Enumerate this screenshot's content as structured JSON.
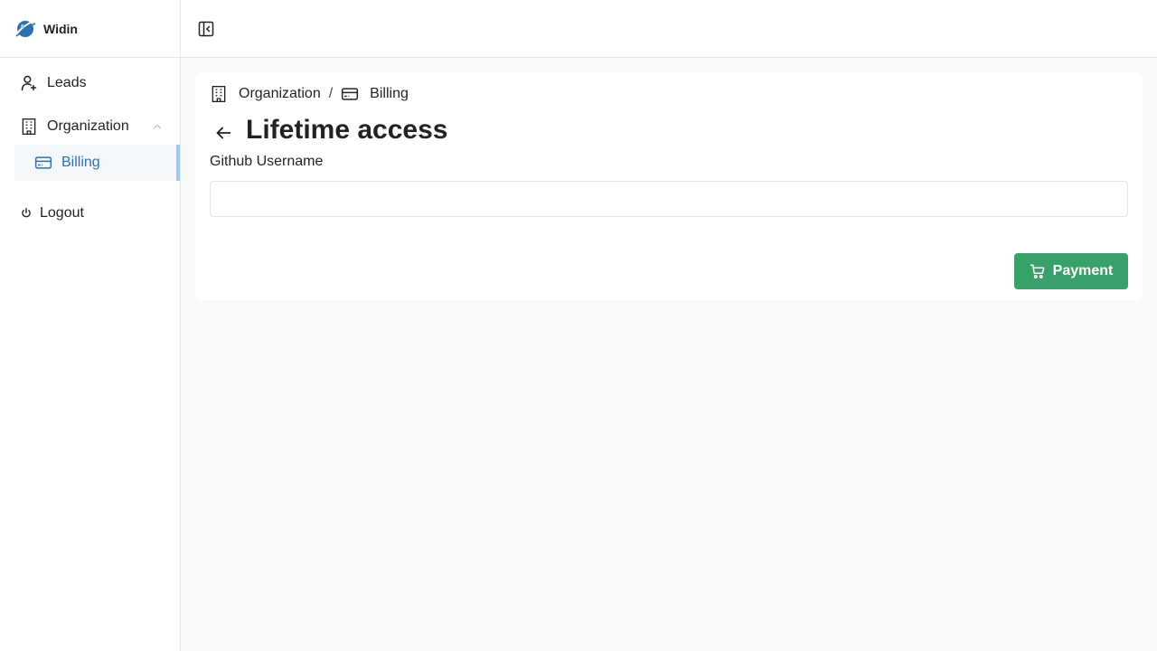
{
  "app": {
    "name": "Widin"
  },
  "sidebar": {
    "items": [
      {
        "label": "Leads",
        "icon": "user-plus-icon"
      },
      {
        "label": "Organization",
        "icon": "building-icon",
        "expanded": true
      },
      {
        "label": "Billing",
        "icon": "credit-card-icon",
        "active": true
      },
      {
        "label": "Logout",
        "icon": "power-icon"
      }
    ]
  },
  "breadcrumb": {
    "items": [
      {
        "label": "Organization",
        "icon": "building-icon"
      },
      {
        "label": "Billing",
        "icon": "credit-card-icon"
      }
    ],
    "separator": "/"
  },
  "page": {
    "title": "Lifetime access",
    "field_label": "Github Username",
    "field_value": "",
    "field_placeholder": "",
    "payment_label": "Payment"
  },
  "colors": {
    "accent": "#2f6fb0",
    "active_bar": "#9ec9ea",
    "payment_button": "#38a169",
    "page_background": "#f8f9fb"
  }
}
